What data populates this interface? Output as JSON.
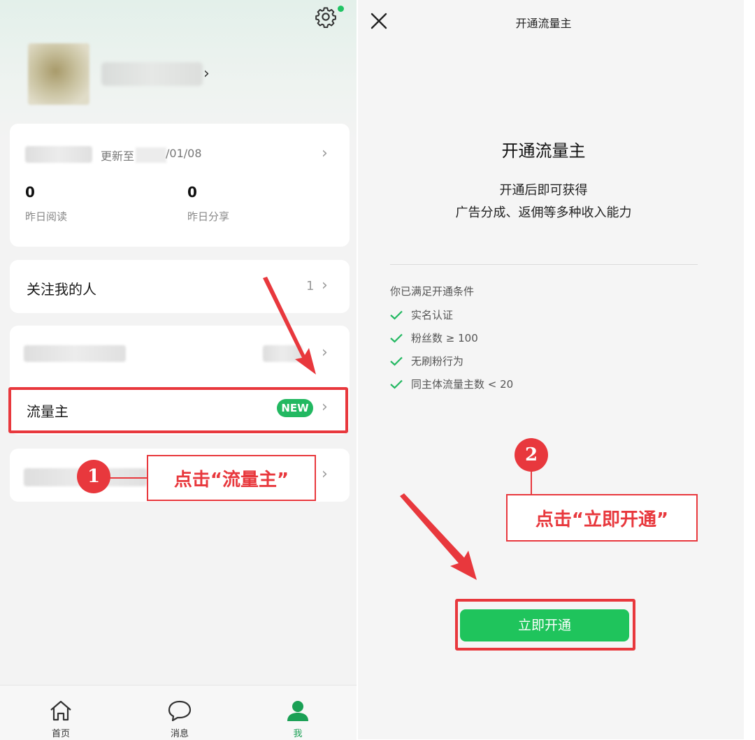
{
  "left": {
    "update_prefix": "更新至",
    "update_date": "/01/08",
    "stats": [
      {
        "value": "0",
        "label": "昨日阅读"
      },
      {
        "value": "0",
        "label": "昨日分享"
      }
    ],
    "followers_label": "关注我的人",
    "followers_count": "1",
    "liuliangzhu_label": "流量主",
    "new_badge": "NEW",
    "step1_number": "1",
    "step1_text": "点击“流量主”",
    "tabs": [
      {
        "label": "首页",
        "icon": "home-icon"
      },
      {
        "label": "消息",
        "icon": "message-icon"
      },
      {
        "label": "我",
        "icon": "profile-icon"
      }
    ]
  },
  "right": {
    "title": "开通流量主",
    "heading": "开通流量主",
    "subtitle_line1": "开通后即可获得",
    "subtitle_line2": "广告分成、返佣等多种收入能力",
    "conditions_heading": "你已满足开通条件",
    "conditions": [
      "实名认证",
      "粉丝数 ≥ 100",
      "无刷粉行为",
      "同主体流量主数 < 20"
    ],
    "step2_number": "2",
    "step2_text": "点击“立即开通”",
    "open_button": "立即开通"
  },
  "colors": {
    "accent_green": "#1fc45c",
    "annotation_red": "#e8383d"
  }
}
